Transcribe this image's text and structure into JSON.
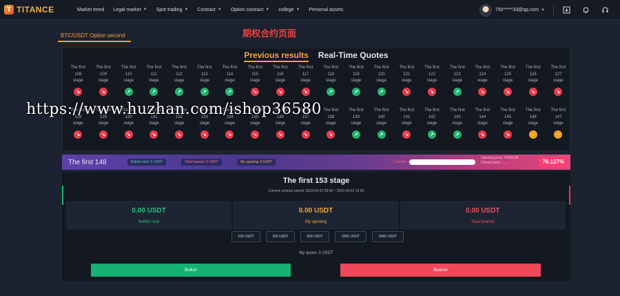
{
  "brand": {
    "logo_letter": "T",
    "name": "TITANCE"
  },
  "nav": [
    {
      "label": "Market trend",
      "dropdown": false
    },
    {
      "label": "Legal market",
      "dropdown": true
    },
    {
      "label": "Spot trading",
      "dropdown": true
    },
    {
      "label": "Contract",
      "dropdown": true
    },
    {
      "label": "Option contract",
      "dropdown": true
    },
    {
      "label": "college",
      "dropdown": true
    },
    {
      "label": "Personal assets",
      "dropdown": false
    }
  ],
  "user": {
    "email": "750*****33@qq.com"
  },
  "header_icons": [
    "download-icon",
    "bell-icon",
    "headset-icon"
  ],
  "page_tab": "BTC/USDT Option second",
  "page_heading": "期权合约页面",
  "results": {
    "tabs": [
      "Previous results",
      "Real-Time Quotes"
    ],
    "active_tab": 0,
    "rows": [
      [
        {
          "l1": "The first",
          "l2": "108",
          "l3": "stage",
          "dir": "down"
        },
        {
          "l1": "The first",
          "l2": "109",
          "l3": "stage",
          "dir": "down"
        },
        {
          "l1": "The first",
          "l2": "110",
          "l3": "stage",
          "dir": "up"
        },
        {
          "l1": "The first",
          "l2": "111",
          "l3": "stage",
          "dir": "up"
        },
        {
          "l1": "The first",
          "l2": "112",
          "l3": "stage",
          "dir": "up"
        },
        {
          "l1": "The first",
          "l2": "113",
          "l3": "stage",
          "dir": "up"
        },
        {
          "l1": "The first",
          "l2": "114",
          "l3": "stage",
          "dir": "up"
        },
        {
          "l1": "The first",
          "l2": "115",
          "l3": "stage",
          "dir": "down"
        },
        {
          "l1": "The first",
          "l2": "116",
          "l3": "stage",
          "dir": "down"
        },
        {
          "l1": "The first",
          "l2": "117",
          "l3": "stage",
          "dir": "down"
        },
        {
          "l1": "The first",
          "l2": "118",
          "l3": "stage",
          "dir": "up"
        },
        {
          "l1": "The first",
          "l2": "119",
          "l3": "stage",
          "dir": "up"
        },
        {
          "l1": "The first",
          "l2": "120",
          "l3": "stage",
          "dir": "up"
        },
        {
          "l1": "The first",
          "l2": "121",
          "l3": "stage",
          "dir": "down"
        },
        {
          "l1": "The first",
          "l2": "122",
          "l3": "stage",
          "dir": "down"
        },
        {
          "l1": "The first",
          "l2": "123",
          "l3": "stage",
          "dir": "up"
        },
        {
          "l1": "The first",
          "l2": "124",
          "l3": "stage",
          "dir": "down"
        },
        {
          "l1": "The first",
          "l2": "125",
          "l3": "stage",
          "dir": "down"
        },
        {
          "l1": "The first",
          "l2": "126",
          "l3": "stage",
          "dir": "down"
        },
        {
          "l1": "The first",
          "l2": "127",
          "l3": "stage",
          "dir": "down"
        }
      ],
      [
        {
          "l1": "The first",
          "l2": "128",
          "l3": "stage",
          "dir": "down"
        },
        {
          "l1": "The first",
          "l2": "129",
          "l3": "stage",
          "dir": "down"
        },
        {
          "l1": "The first",
          "l2": "130",
          "l3": "stage",
          "dir": "down"
        },
        {
          "l1": "The first",
          "l2": "131",
          "l3": "stage",
          "dir": "down"
        },
        {
          "l1": "The first",
          "l2": "132",
          "l3": "stage",
          "dir": "down"
        },
        {
          "l1": "The first",
          "l2": "133",
          "l3": "stage",
          "dir": "down"
        },
        {
          "l1": "The first",
          "l2": "134",
          "l3": "stage",
          "dir": "down"
        },
        {
          "l1": "The first",
          "l2": "135",
          "l3": "stage",
          "dir": "down"
        },
        {
          "l1": "The first",
          "l2": "136",
          "l3": "stage",
          "dir": "down"
        },
        {
          "l1": "The first",
          "l2": "137",
          "l3": "stage",
          "dir": "down"
        },
        {
          "l1": "The first",
          "l2": "138",
          "l3": "stage",
          "dir": "down"
        },
        {
          "l1": "The first",
          "l2": "139",
          "l3": "stage",
          "dir": "up"
        },
        {
          "l1": "The first",
          "l2": "140",
          "l3": "stage",
          "dir": "up"
        },
        {
          "l1": "The first",
          "l2": "141",
          "l3": "stage",
          "dir": "down"
        },
        {
          "l1": "The first",
          "l2": "142",
          "l3": "stage",
          "dir": "up"
        },
        {
          "l1": "The first",
          "l2": "143",
          "l3": "stage",
          "dir": "up"
        },
        {
          "l1": "The first",
          "l2": "144",
          "l3": "stage",
          "dir": "down"
        },
        {
          "l1": "The first",
          "l2": "145",
          "l3": "stage",
          "dir": "down"
        },
        {
          "l1": "The first",
          "l2": "146",
          "l3": "stage",
          "dir": "flat"
        },
        {
          "l1": "The first",
          "l2": "147",
          "l3": "stage",
          "dir": "flat"
        }
      ]
    ]
  },
  "watermark": "https://www.huzhan.com/ishop36580",
  "status_bar": {
    "current_stage": "The first 148",
    "bullish_total": "Bullish total: 0 USDT",
    "bearish_total": "Total bearish: 0 USDT",
    "my_opening": "My opening: 0 USDT",
    "contrast_label": "Contrast",
    "opening_price": "Opening price: 41000.85",
    "closed_price": "Closed price: ......",
    "percent": "76.127%",
    "progress": 1.0
  },
  "order": {
    "title": "The first 153 stage",
    "period": "Current contract period: 2022-04-22 09:58 ~ 2022-04-22 10:03",
    "stats": [
      {
        "value": "0.00 USDT",
        "label": "Bullish total",
        "tone": "green"
      },
      {
        "value": "0.00 USDT",
        "label": "My opening",
        "tone": "orange"
      },
      {
        "value": "0.00 USDT",
        "label": "Total bearish",
        "tone": "red"
      }
    ],
    "amounts": [
      "100 USDT",
      "200 USDT",
      "500 USDT",
      "2000 USDT",
      "5000 USDT"
    ],
    "quota": "My quota:  0 USDT",
    "bullish_button": "Bullish",
    "bearish_button": "Bearish"
  },
  "colors": {
    "accent": "#f2a53b",
    "up": "#21b36e",
    "down": "#e83b4c",
    "flat": "#f2a223"
  }
}
